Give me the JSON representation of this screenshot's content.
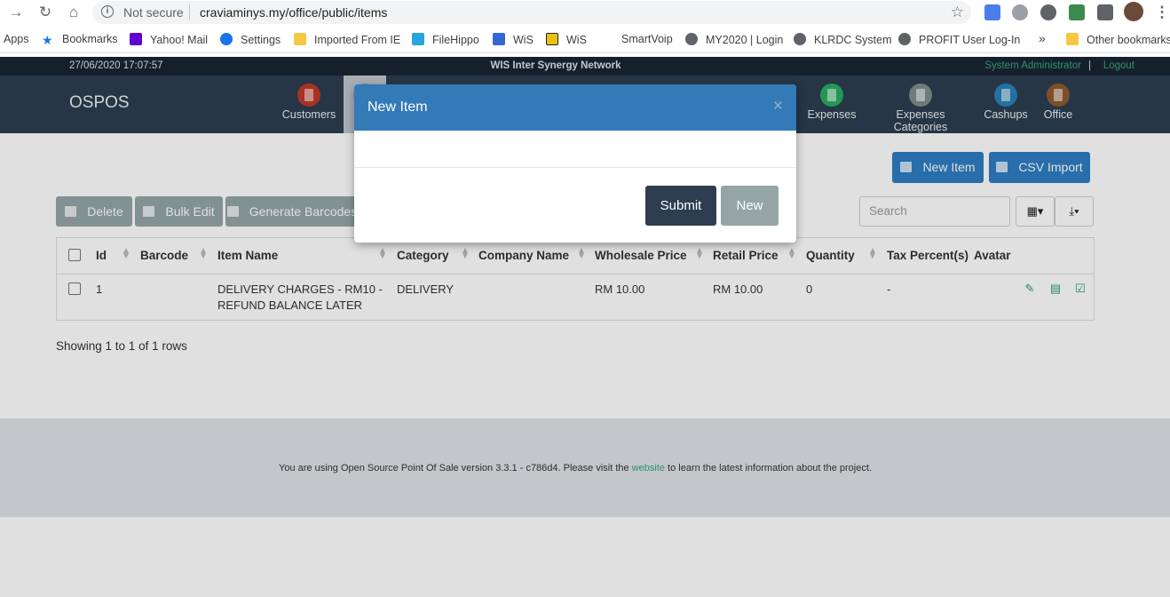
{
  "browser": {
    "security_label": "Not secure",
    "url": "craviaminys.my/office/public/items",
    "bookmarks": [
      {
        "label": "Apps",
        "icon": "apps-grid-icon",
        "color": "#4285f4"
      },
      {
        "label": "Bookmarks",
        "icon": "star-icon",
        "color": "#1a73e8"
      },
      {
        "label": "Yahoo! Mail",
        "icon": "yahoo-icon",
        "color": "#6001d2"
      },
      {
        "label": "Settings",
        "icon": "gear-icon",
        "color": "#1a73e8"
      },
      {
        "label": "Imported From IE",
        "icon": "folder-icon",
        "color": "#f6c744"
      },
      {
        "label": "FileHippo",
        "icon": "filehippo-icon",
        "color": "#2aa3de"
      },
      {
        "label": "WiS",
        "icon": "calendar-icon",
        "color": "#3367d6"
      },
      {
        "label": "WiS",
        "icon": "wis-icon",
        "color": "#e7c20f"
      },
      {
        "label": "SmartVoip",
        "icon": "",
        "color": ""
      },
      {
        "label": "MY2020 | Login",
        "icon": "globe-icon",
        "color": "#5f6368"
      },
      {
        "label": "KLRDC System",
        "icon": "globe-icon",
        "color": "#5f6368"
      },
      {
        "label": "PROFIT User Log-In",
        "icon": "globe-icon",
        "color": "#5f6368"
      },
      {
        "label": "»",
        "icon": "",
        "color": ""
      },
      {
        "label": "Other bookmarks",
        "icon": "folder-icon",
        "color": "#f6c744"
      }
    ]
  },
  "topbar": {
    "datetime": "27/06/2020 17:07:57",
    "company": "WIS Inter Synergy Network",
    "user": "System Administrator",
    "logout": "Logout"
  },
  "navbar": {
    "brand": "OSPOS",
    "items": [
      {
        "label": "Customers",
        "icon": "customers-icon",
        "color": "#c0392b"
      },
      {
        "label": "",
        "icon": "items-icon",
        "color": "#95a5a6"
      },
      {
        "label": "Expenses",
        "icon": "expenses-icon",
        "color": "#27ae60"
      },
      {
        "label": "Expenses Categories",
        "icon": "expenses-categories-icon",
        "color": "#7f8c8d"
      },
      {
        "label": "Cashups",
        "icon": "cashups-icon",
        "color": "#2980b9"
      },
      {
        "label": "Office",
        "icon": "office-icon",
        "color": "#8e5a2e"
      }
    ]
  },
  "toolbar": {
    "new_item": "New Item",
    "csv_import": "CSV Import",
    "delete": "Delete",
    "bulk_edit": "Bulk Edit",
    "generate_barcodes": "Generate Barcodes",
    "search_placeholder": "Search"
  },
  "table": {
    "columns": [
      "Id",
      "Barcode",
      "Item Name",
      "Category",
      "Company Name",
      "Wholesale Price",
      "Retail Price",
      "Quantity",
      "Tax Percent(s)",
      "Avatar"
    ],
    "rows": [
      {
        "id": "1",
        "barcode": "",
        "item_name_line1": "DELIVERY CHARGES - RM10 -",
        "item_name_line2": "REFUND BALANCE LATER",
        "category": "DELIVERY",
        "company_name": "",
        "wholesale_price": "RM 10.00",
        "retail_price": "RM 10.00",
        "quantity": "0",
        "tax_percents": "-",
        "avatar": ""
      }
    ],
    "showing": "Showing 1 to 1 of 1 rows"
  },
  "footer": {
    "text_before": "You are using Open Source Point Of Sale version 3.3.1 - c786d4. Please visit the",
    "link": "website",
    "text_after": "to learn the latest information about the project."
  },
  "modal": {
    "title": "New Item",
    "close": "×",
    "submit": "Submit",
    "new": "New"
  }
}
